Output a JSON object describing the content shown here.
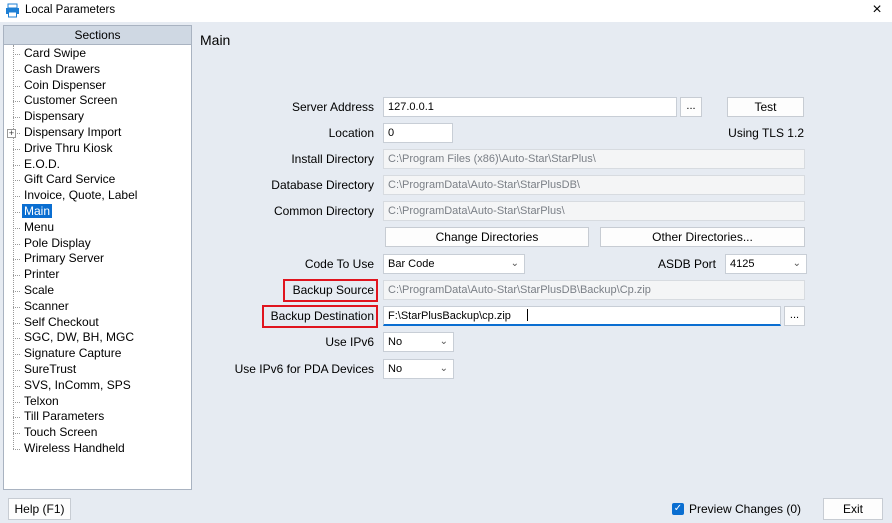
{
  "window": {
    "title": "Local Parameters",
    "close_glyph": "×",
    "app_icon": "printer-icon"
  },
  "sections": {
    "header": "Sections",
    "items": [
      {
        "label": "Card Swipe"
      },
      {
        "label": "Cash Drawers"
      },
      {
        "label": "Coin Dispenser"
      },
      {
        "label": "Customer Screen"
      },
      {
        "label": "Dispensary"
      },
      {
        "label": "Dispensary Import",
        "expandable": true
      },
      {
        "label": "Drive Thru Kiosk"
      },
      {
        "label": "E.O.D."
      },
      {
        "label": "Gift Card Service"
      },
      {
        "label": "Invoice, Quote, Label"
      },
      {
        "label": "Main",
        "selected": true
      },
      {
        "label": "Menu"
      },
      {
        "label": "Pole Display"
      },
      {
        "label": "Primary Server"
      },
      {
        "label": "Printer"
      },
      {
        "label": "Scale"
      },
      {
        "label": "Scanner"
      },
      {
        "label": "Self Checkout"
      },
      {
        "label": "SGC, DW, BH, MGC"
      },
      {
        "label": "Signature Capture"
      },
      {
        "label": "SureTrust"
      },
      {
        "label": "SVS, InComm, SPS"
      },
      {
        "label": "Telxon"
      },
      {
        "label": "Till Parameters"
      },
      {
        "label": "Touch Screen"
      },
      {
        "label": "Wireless Handheld"
      }
    ]
  },
  "main": {
    "title": "Main",
    "server_address": {
      "label": "Server Address",
      "value": "127.0.0.1",
      "browse": "...",
      "test": "Test"
    },
    "location": {
      "label": "Location",
      "value": "0",
      "tls": "Using TLS 1.2"
    },
    "install_directory": {
      "label": "Install Directory",
      "value": "C:\\Program Files (x86)\\Auto-Star\\StarPlus\\"
    },
    "database_directory": {
      "label": "Database Directory",
      "value": "C:\\ProgramData\\Auto-Star\\StarPlusDB\\"
    },
    "common_directory": {
      "label": "Common Directory",
      "value": "C:\\ProgramData\\Auto-Star\\StarPlus\\"
    },
    "change_directories": "Change Directories",
    "other_directories": "Other Directories...",
    "code_to_use": {
      "label": "Code To Use",
      "value": "Bar Code"
    },
    "asdb_port": {
      "label": "ASDB Port",
      "value": "4125"
    },
    "backup_source": {
      "label": "Backup Source",
      "value": "C:\\ProgramData\\Auto-Star\\StarPlusDB\\Backup\\Cp.zip"
    },
    "backup_destination": {
      "label": "Backup Destination",
      "value": "F:\\StarPlusBackup\\cp.zip",
      "browse": "..."
    },
    "use_ipv6": {
      "label": "Use IPv6",
      "value": "No"
    },
    "use_ipv6_pda": {
      "label": "Use IPv6 for PDA Devices",
      "value": "No"
    },
    "highlight_color": "#e0141e"
  },
  "footer": {
    "help": "Help (F1)",
    "preview": "Preview Changes (0)",
    "preview_checked": true,
    "exit": "Exit"
  }
}
